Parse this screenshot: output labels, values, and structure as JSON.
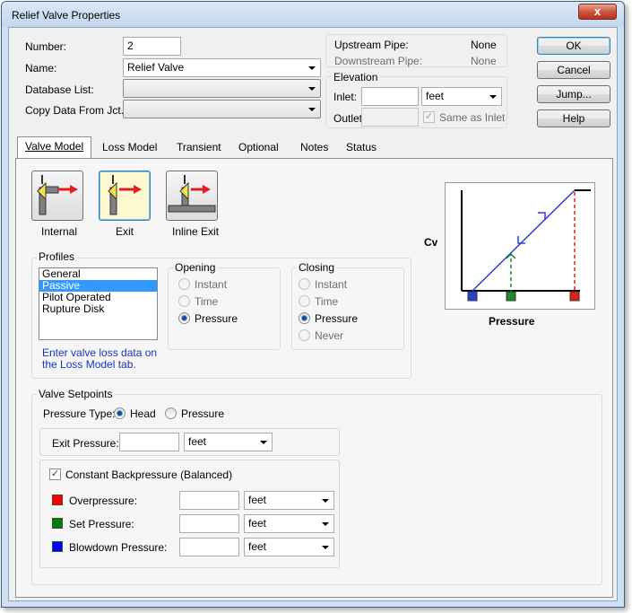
{
  "window": {
    "title": "Relief Valve Properties",
    "close_glyph": "x"
  },
  "form": {
    "number_label": "Number:",
    "number_value": "2",
    "name_label": "Name:",
    "name_value": "Relief Valve",
    "database_label": "Database List:",
    "database_value": "",
    "copy_label": "Copy Data From Jct...",
    "copy_value": ""
  },
  "pipes": {
    "upstream_label": "Upstream Pipe:",
    "upstream_value": "None",
    "downstream_label": "Downstream Pipe:",
    "downstream_value": "None"
  },
  "elevation": {
    "title": "Elevation",
    "inlet_label": "Inlet:",
    "inlet_value": "",
    "inlet_unit": "feet",
    "outlet_label": "Outlet:",
    "outlet_value": "",
    "same_as_inlet_label": "Same as Inlet",
    "same_as_inlet_checked": true
  },
  "buttons": {
    "ok": "OK",
    "cancel": "Cancel",
    "jump": "Jump...",
    "help": "Help"
  },
  "tabs": [
    {
      "label": "Valve Model",
      "active": true
    },
    {
      "label": "Loss Model"
    },
    {
      "label": "Transient"
    },
    {
      "label": "Optional"
    },
    {
      "label": "Notes"
    },
    {
      "label": "Status"
    }
  ],
  "valve_types": [
    {
      "label": "Internal",
      "selected": false
    },
    {
      "label": "Exit",
      "selected": true
    },
    {
      "label": "Inline Exit",
      "selected": false
    }
  ],
  "profiles": {
    "title": "Profiles",
    "items": [
      "General",
      "Passive",
      "Pilot Operated",
      "Rupture Disk"
    ],
    "selected": "Passive",
    "note": "Enter valve loss data on the Loss Model tab.",
    "opening": {
      "title": "Opening",
      "options": [
        "Instant",
        "Time",
        "Pressure"
      ],
      "selected": "Pressure"
    },
    "closing": {
      "title": "Closing",
      "options": [
        "Instant",
        "Time",
        "Pressure",
        "Never"
      ],
      "selected": "Pressure"
    }
  },
  "graph": {
    "ylabel": "Cv",
    "xlabel": "Pressure",
    "colors": {
      "blowdown": "#2b3fd6",
      "set": "#1e8a2c",
      "over": "#e02020",
      "curve": "#2b3fd6"
    }
  },
  "setpoints": {
    "title": "Valve Setpoints",
    "pressure_type_label": "Pressure Type:",
    "pressure_type_options": [
      "Head",
      "Pressure"
    ],
    "pressure_type_selected": "Head",
    "exit_pressure_label": "Exit Pressure:",
    "exit_pressure_value": "",
    "exit_pressure_unit": "feet",
    "constant_backpressure_label": "Constant Backpressure (Balanced)",
    "constant_backpressure_checked": true,
    "rows": [
      {
        "label": "Overpressure:",
        "value": "",
        "unit": "feet",
        "color": "#ff0000"
      },
      {
        "label": "Set Pressure:",
        "value": "",
        "unit": "feet",
        "color": "#008000"
      },
      {
        "label": "Blowdown Pressure:",
        "value": "",
        "unit": "feet",
        "color": "#0000ff"
      }
    ]
  }
}
